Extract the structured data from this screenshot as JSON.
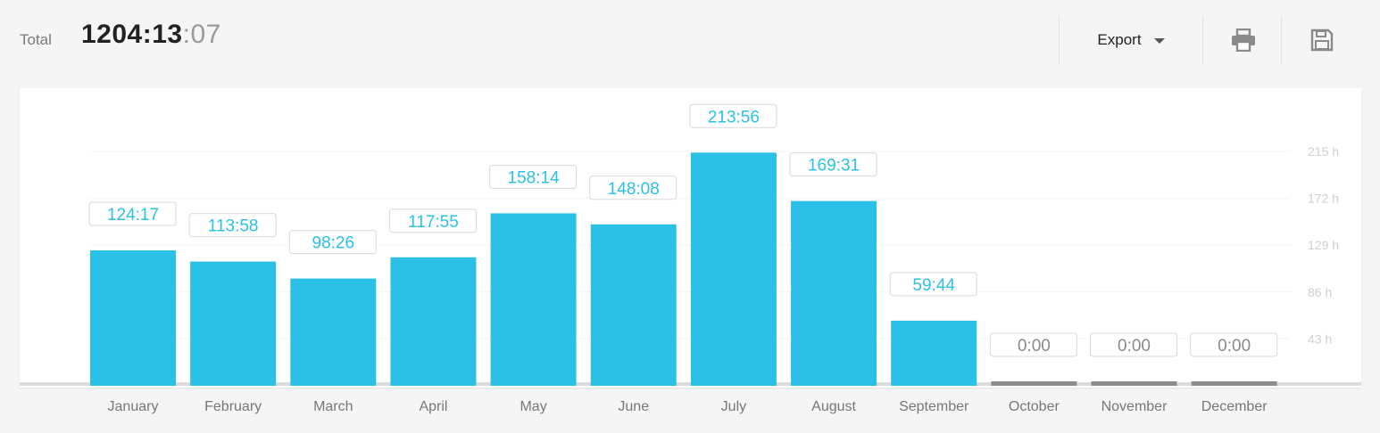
{
  "header": {
    "total_label": "Total",
    "total_hm": "1204:13",
    "total_sec": ":07",
    "export_label": "Export",
    "print_icon": "printer-icon",
    "save_icon": "floppy-disk-icon"
  },
  "colors": {
    "bar": "#2bc1e6",
    "bar_empty": "#8c8c8c",
    "label_active": "#2bc1e6",
    "label_empty": "#8a8a8a",
    "baseline": "#dcdcdc"
  },
  "chart_data": {
    "type": "bar",
    "categories": [
      "January",
      "February",
      "March",
      "April",
      "May",
      "June",
      "July",
      "August",
      "September",
      "October",
      "November",
      "December"
    ],
    "values": [
      124.28,
      113.97,
      98.43,
      117.92,
      158.23,
      148.13,
      213.93,
      169.52,
      59.73,
      0,
      0,
      0
    ],
    "data_labels": [
      "124:17",
      "113:58",
      "98:26",
      "117:55",
      "158:14",
      "148:08",
      "213:56",
      "169:31",
      "59:44",
      "0:00",
      "0:00",
      "0:00"
    ],
    "yticks": [
      43,
      86,
      129,
      172,
      215
    ],
    "ytick_labels": [
      "43 h",
      "86 h",
      "129 h",
      "172 h",
      "215 h"
    ],
    "ylim": [
      0,
      215
    ],
    "grid": true
  }
}
